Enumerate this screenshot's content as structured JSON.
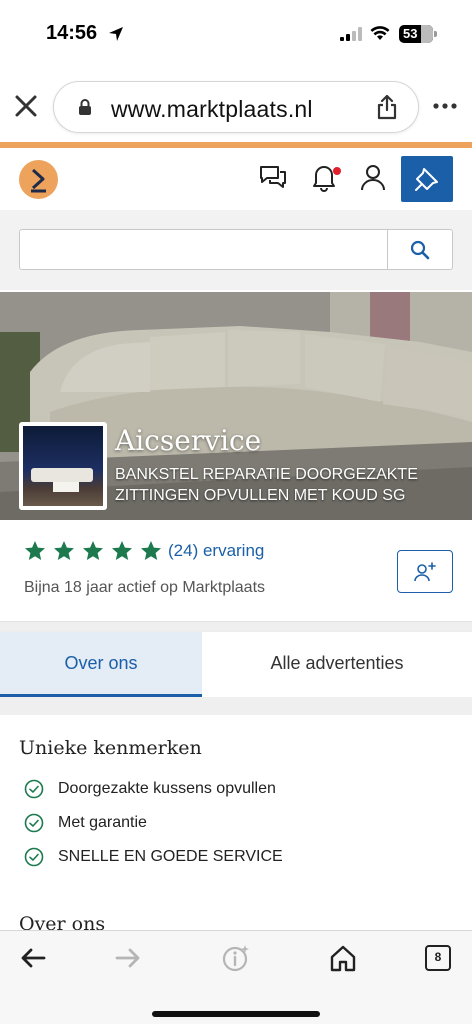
{
  "status_bar": {
    "time": "14:56",
    "battery": "53"
  },
  "browser": {
    "url": "www.marktplaats.nl",
    "tab_count": "8"
  },
  "colors": {
    "brand_orange": "#eda35b",
    "brand_blue": "#1a5fa8",
    "star_green": "#1d7a4e",
    "bell_badge": "#e0202b"
  },
  "header": {
    "icons": [
      "messages-icon",
      "notifications-icon",
      "profile-icon",
      "place-ad-icon"
    ]
  },
  "search": {
    "value": "",
    "placeholder": ""
  },
  "shop": {
    "name": "Aicservice",
    "tagline": "BANKSTEL REPARATIE DOORGEZAKTE ZITTINGEN OPVULLEN MET KOUD SG"
  },
  "rating": {
    "stars": 5,
    "review_link": "(24) ervaring",
    "active_since": "Bijna 18 jaar actief op Marktplaats"
  },
  "tabs": [
    {
      "label": "Over ons",
      "active": true
    },
    {
      "label": "Alle advertenties",
      "active": false
    }
  ],
  "features": {
    "title": "Unieke kenmerken",
    "items": [
      "Doorgezakte kussens opvullen",
      "Met garantie",
      "SNELLE EN GOEDE SERVICE"
    ]
  },
  "about": {
    "title": "Over ons"
  }
}
